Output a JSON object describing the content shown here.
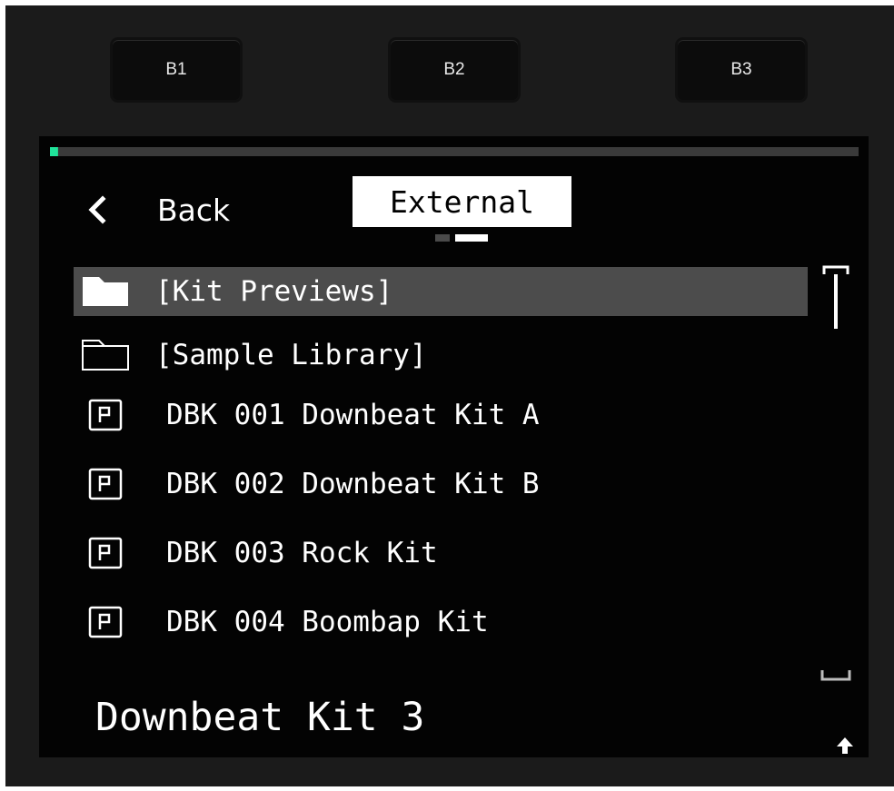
{
  "hardware_buttons": [
    {
      "label": "B1"
    },
    {
      "label": "B2"
    },
    {
      "label": "B3"
    }
  ],
  "progress": {
    "value": 0.01,
    "color": "#20d18d"
  },
  "header": {
    "back_label": "Back",
    "location": "External",
    "page_dots": {
      "count": 2,
      "active": 2
    }
  },
  "list": {
    "items": [
      {
        "type": "folder",
        "icon": "folder-filled-icon",
        "label": "[Kit Previews]",
        "selected": true
      },
      {
        "type": "folder",
        "icon": "folder-outline-icon",
        "label": "[Sample Library]",
        "selected": false
      },
      {
        "type": "preset",
        "icon": "preset-icon",
        "label": "DBK 001 Downbeat Kit A",
        "selected": false
      },
      {
        "type": "preset",
        "icon": "preset-icon",
        "label": "DBK 002 Downbeat Kit B",
        "selected": false
      },
      {
        "type": "preset",
        "icon": "preset-icon",
        "label": "DBK 003 Rock Kit",
        "selected": false
      },
      {
        "type": "preset",
        "icon": "preset-icon",
        "label": "DBK 004 Boombap Kit",
        "selected": false
      }
    ]
  },
  "footer": {
    "current_kit": "Downbeat Kit 3",
    "icon": "up-arrow-icon"
  },
  "colors": {
    "background": "#030303",
    "selection": "#4c4c4c",
    "accent": "#20d18d",
    "text": "#ffffff"
  }
}
